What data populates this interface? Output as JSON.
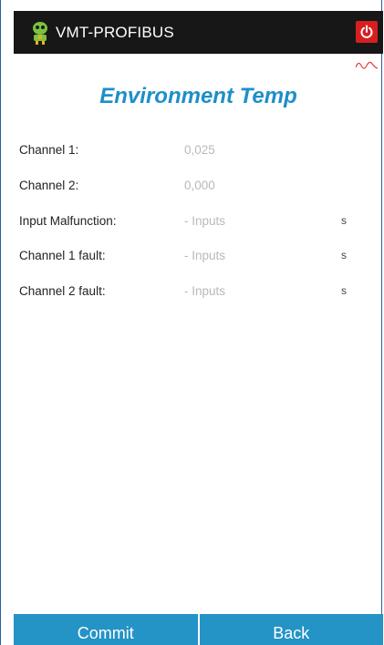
{
  "app": {
    "title": "VMT-PROFIBUS",
    "logo_icon": "robot-logo-icon",
    "power_icon": "power-icon",
    "signal_icon": "signal-wave-icon"
  },
  "page": {
    "title": "Environment Temp"
  },
  "rows": [
    {
      "label": "Channel 1:",
      "value": "0,025",
      "unit": ""
    },
    {
      "label": "Channel 2:",
      "value": "0,000",
      "unit": ""
    },
    {
      "label": "Input Malfunction:",
      "value": "- Inputs",
      "unit": "s"
    },
    {
      "label": "Channel 1 fault:",
      "value": "- Inputs",
      "unit": "s"
    },
    {
      "label": "Channel 2 fault:",
      "value": "- Inputs",
      "unit": "s"
    }
  ],
  "buttons": {
    "commit": "Commit",
    "back": "Back"
  },
  "colors": {
    "accent": "#1d8fc9",
    "button": "#2493c6",
    "action_bar": "#171717",
    "power": "#d81f1f"
  }
}
